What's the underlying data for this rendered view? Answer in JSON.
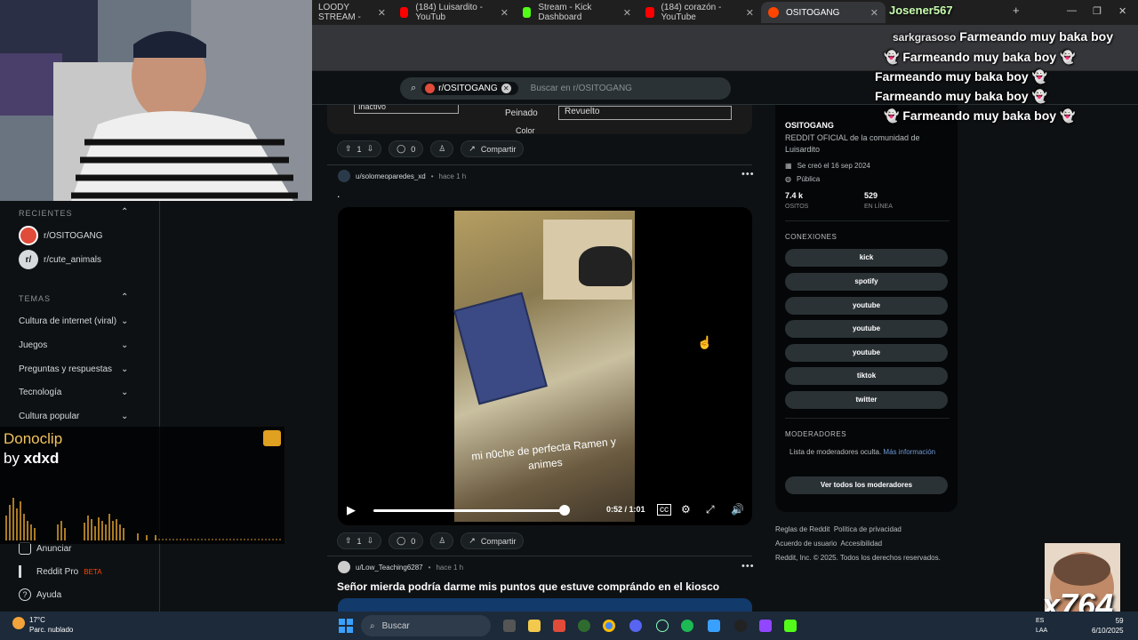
{
  "browser": {
    "tabs": [
      {
        "label": "LOODY STREAM -",
        "color": "#888888"
      },
      {
        "label": "(184) Luisardito - YouTub",
        "color": "#ff0000"
      },
      {
        "label": "Stream - Kick Dashboard",
        "color": "#53fc18"
      },
      {
        "label": "(184) corazón - YouTube",
        "color": "#ff0000"
      },
      {
        "label": "OSITOGANG",
        "color": "#ff4500"
      }
    ],
    "new_tab": "+"
  },
  "header": {
    "search_chip": "r/OSITOGANG",
    "search_placeholder": "Buscar en r/OSITOGANG"
  },
  "sidebar": {
    "recent_title": "RECIENTES",
    "recent": [
      {
        "label": "r/OSITOGANG",
        "avatar": "",
        "color": "#e04b3a"
      },
      {
        "label": "r/cute_animals",
        "avatar": "r/",
        "color": "#d7dadc"
      }
    ],
    "topics_title": "TEMAS",
    "topics": [
      "Cultura de internet (viral)",
      "Juegos",
      "Preguntas y respuestas",
      "Tecnología",
      "Cultura popular"
    ],
    "bottom": [
      {
        "label": "Anunciar",
        "badge": ""
      },
      {
        "label": "Reddit Pro",
        "badge": "BETA"
      },
      {
        "label": "Ayuda",
        "badge": ""
      }
    ]
  },
  "feed": {
    "top_actions": {
      "votes": "1",
      "comments": "0",
      "share": "Compartir"
    },
    "partial_post": {
      "field1": "Inactivo",
      "field2_label": "Peinado",
      "field2_value": "Revuelto",
      "field3_label": "Color"
    },
    "post1": {
      "user": "u/solomeoparedes_xd",
      "time": "hace 1 h",
      "title": ".",
      "video_caption": "mi n0che de perfecta Ramen y animes",
      "video_time": "0:52 / 1:01",
      "video_progress": 0.852,
      "votes": "1",
      "comments": "0",
      "share": "Compartir"
    },
    "post2": {
      "user": "u/Low_Teaching6287",
      "time": "hace 1 h",
      "title": "Señor mierda podría darme mis puntos que estuve comprándo en el kiosco"
    }
  },
  "community": {
    "name": "OSITOGANG",
    "description": "REDDIT OFICIAL de la comunidad de Luisardito",
    "created": "Se creó el 16 sep 2024",
    "visibility": "Pública",
    "members": "7.4 k",
    "members_label": "OSITOS",
    "online": "529",
    "online_label": "EN LÍNEA",
    "connections_title": "CONEXIONES",
    "connections": [
      "kick",
      "spotify",
      "youtube",
      "youtube",
      "youtube",
      "tiktok",
      "twitter"
    ],
    "mods_title": "MODERADORES",
    "mods_text": "Lista de moderadores oculta.",
    "mods_link": "Más información",
    "mods_button": "Ver todos los moderadores"
  },
  "footer": {
    "line1a": "Reglas de Reddit",
    "line1b": "Política de privacidad",
    "line2a": "Acuerdo de usuario",
    "line2b": "Accesibilidad",
    "line3": "Reddit, Inc. © 2025. Todos los derechos reservados."
  },
  "overlay": {
    "chat_user": "Josener567",
    "chat_user2": "sarkgrasoso",
    "chat_message": "Farmeando muy baka boy",
    "dono_title": "Donoclip",
    "dono_by": "by",
    "dono_user": "xdxd",
    "cam_counter": "x764"
  },
  "taskbar": {
    "temp": "17°C",
    "weather": "Parc. nublado",
    "search": "Buscar",
    "lang1": "ES",
    "lang2": "LAA",
    "time": "59",
    "date": "6/10/2025"
  }
}
